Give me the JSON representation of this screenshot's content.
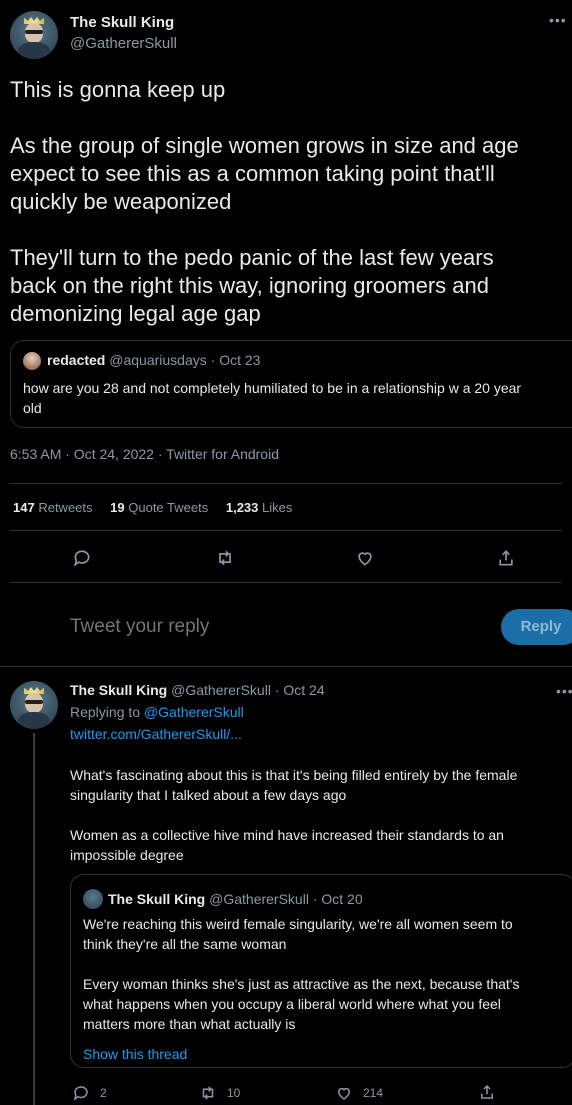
{
  "main_tweet": {
    "author": {
      "name": "The Skull King",
      "handle": "@GathererSkull"
    },
    "text_lines": [
      "This is gonna keep up",
      "As the group of single women grows in size and age",
      "expect to see this as a common taking point that'll",
      "quickly be weaponized",
      "They'll turn to the pedo panic of the last few years",
      "back on the right this way, ignoring groomers and",
      "demonizing legal age gap"
    ],
    "quoted": {
      "name": "redacted",
      "handle": "@aquariusdays",
      "date": "Oct 23",
      "separator": "·",
      "text_line_1": "how are you 28 and not completely humiliated to be in a relationship w a 20 year",
      "text_line_2": "old"
    },
    "timestamp": "6:53 AM · Oct 24, 2022 · Twitter for Android",
    "stats": {
      "retweets_count": "147",
      "retweets_label": "Retweets",
      "quote_tweets_count": "19",
      "quote_tweets_label": "Quote Tweets",
      "likes_count": "1,233",
      "likes_label": "Likes"
    },
    "composer": {
      "placeholder": "Tweet your reply",
      "button_label": "Reply"
    }
  },
  "reply_tweet": {
    "author": {
      "name": "The Skull King",
      "handle": "@GathererSkull",
      "date": "Oct 24",
      "separator": "·"
    },
    "replying_to_label": "Replying to",
    "replying_to_handle": "@GathererSkull",
    "link": "twitter.com/GathererSkull/...",
    "text_lines": [
      "What's fascinating about this is that it's being filled entirely by the female",
      "singularity that I talked about a few days ago",
      "Women as a collective hive mind have increased their standards to an",
      "impossible degree"
    ],
    "quoted": {
      "name": "The Skull King",
      "handle": "@GathererSkull",
      "date": "Oct 20",
      "separator": "·",
      "text_lines": [
        "We're reaching this weird female singularity, we're all women seem to",
        "think they're all the same woman",
        "Every woman thinks she's just as attractive as the next, because that's",
        "what happens when you occupy a liberal world where what you feel",
        "matters more than what actually is"
      ],
      "show_thread": "Show this thread"
    },
    "action_counts": {
      "replies": "2",
      "retweets": "10",
      "likes": "214"
    }
  },
  "colors": {
    "background": "#000000",
    "text": "#e7e9ea",
    "muted": "#8b98a5",
    "accent": "#1d9bf0",
    "divider": "#2f3336"
  },
  "icons": [
    "more-icon",
    "reply-icon",
    "retweet-icon",
    "like-icon",
    "share-icon"
  ]
}
